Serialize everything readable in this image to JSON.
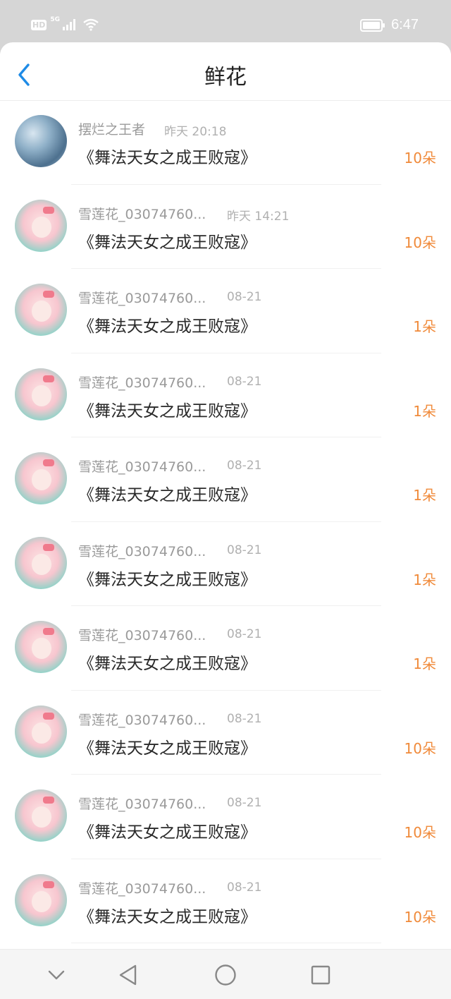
{
  "status_bar": {
    "hd_label": "HD",
    "network_label": "5G",
    "clock": "6:47"
  },
  "header": {
    "title": "鲜花"
  },
  "items": [
    {
      "name": "摆烂之王者",
      "time": "昨天 20:18",
      "title": "《舞法天女之成王败寇》",
      "count": "10朵",
      "avatar": "crystal"
    },
    {
      "name": "雪莲花_03074760...",
      "time": "昨天 14:21",
      "title": "《舞法天女之成王败寇》",
      "count": "10朵",
      "avatar": "anime"
    },
    {
      "name": "雪莲花_03074760...",
      "time": "08-21",
      "title": "《舞法天女之成王败寇》",
      "count": "1朵",
      "avatar": "anime"
    },
    {
      "name": "雪莲花_03074760...",
      "time": "08-21",
      "title": "《舞法天女之成王败寇》",
      "count": "1朵",
      "avatar": "anime"
    },
    {
      "name": "雪莲花_03074760...",
      "time": "08-21",
      "title": "《舞法天女之成王败寇》",
      "count": "1朵",
      "avatar": "anime"
    },
    {
      "name": "雪莲花_03074760...",
      "time": "08-21",
      "title": "《舞法天女之成王败寇》",
      "count": "1朵",
      "avatar": "anime"
    },
    {
      "name": "雪莲花_03074760...",
      "time": "08-21",
      "title": "《舞法天女之成王败寇》",
      "count": "1朵",
      "avatar": "anime"
    },
    {
      "name": "雪莲花_03074760...",
      "time": "08-21",
      "title": "《舞法天女之成王败寇》",
      "count": "10朵",
      "avatar": "anime"
    },
    {
      "name": "雪莲花_03074760...",
      "time": "08-21",
      "title": "《舞法天女之成王败寇》",
      "count": "10朵",
      "avatar": "anime"
    },
    {
      "name": "雪莲花_03074760...",
      "time": "08-21",
      "title": "《舞法天女之成王败寇》",
      "count": "10朵",
      "avatar": "anime"
    }
  ],
  "colors": {
    "accent_blue": "#1e8be6",
    "count_orange": "#f08a3a",
    "status_bar_bg": "#d6d6d6"
  },
  "icons": {
    "back": "chevron-left-icon",
    "nav_hide": "chevron-down-icon",
    "nav_back": "triangle-back-icon",
    "nav_home": "circle-home-icon",
    "nav_recents": "square-recents-icon"
  }
}
